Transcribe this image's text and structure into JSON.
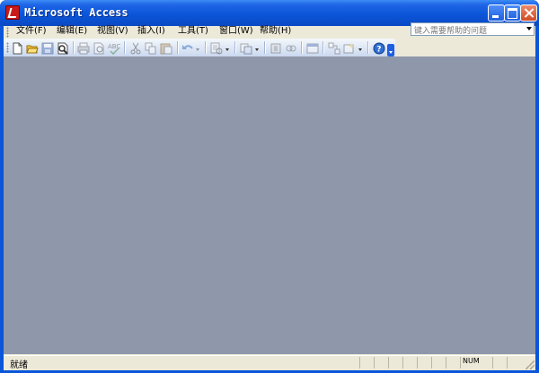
{
  "window": {
    "title": "Microsoft Access"
  },
  "menu": [
    {
      "label": "文件(F)"
    },
    {
      "label": "编辑(E)"
    },
    {
      "label": "视图(V)"
    },
    {
      "label": "插入(I)"
    },
    {
      "label": "工具(T)"
    },
    {
      "label": "窗口(W)"
    },
    {
      "label": "帮助(H)"
    }
  ],
  "help_search": {
    "placeholder": "键入需要帮助的问题"
  },
  "toolbar_icons": [
    "new-icon",
    "open-icon",
    "save-icon",
    "file-search-icon",
    "print-icon",
    "print-preview-icon",
    "spelling-icon",
    "cut-icon",
    "copy-icon",
    "paste-icon",
    "undo-icon",
    "analyze-icon",
    "office-links-icon",
    "code-icon",
    "script-icon",
    "properties-icon",
    "relationships-icon",
    "new-object-icon",
    "help-icon"
  ],
  "statusbar": {
    "status": "就绪",
    "indicator": "NUM"
  },
  "colors": {
    "workspace": "#8f98ab",
    "titlebar": "#0a55d9"
  }
}
